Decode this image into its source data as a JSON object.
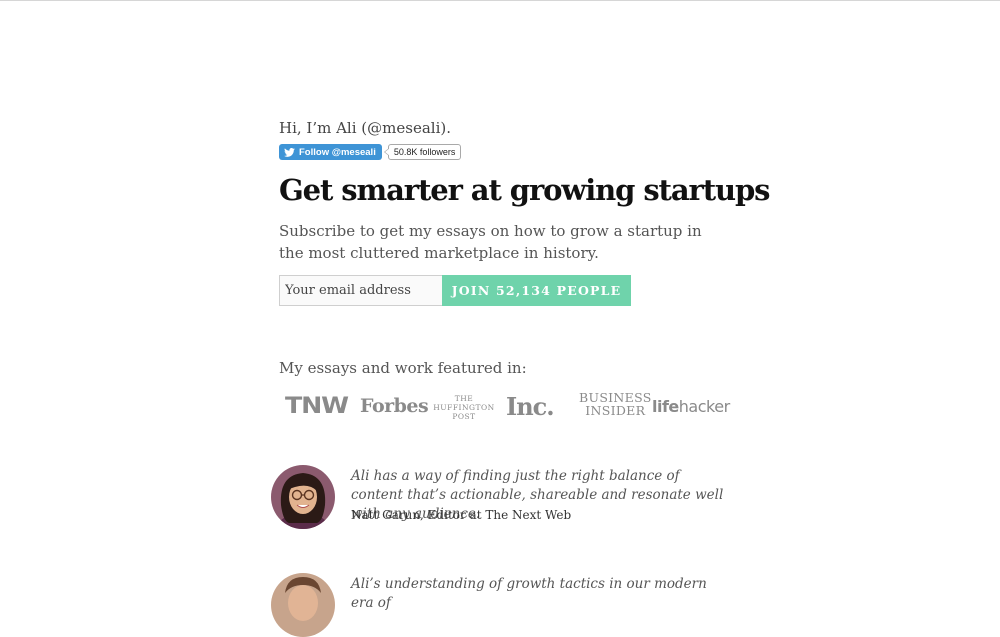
{
  "intro": "Hi, I’m Ali (@meseali).",
  "twitter": {
    "follow_label": "Follow @meseali",
    "followers": "50.8K followers",
    "brand_color": "#3e94d6"
  },
  "headline": "Get smarter at growing startups",
  "subtitle": "Subscribe to get my essays on how to grow a startup in the most cluttered marketplace in history.",
  "signup": {
    "email_placeholder": "Your email address",
    "join_label": "JOIN 52,134 PEOPLE",
    "accent_color": "#6fd3ab"
  },
  "featured": {
    "label": "My essays and work featured in:",
    "logos": {
      "tnw": "TNW",
      "forbes": "Forbes",
      "huffington_line1": "THE",
      "huffington_line2": "HUFFINGTON",
      "huffington_line3": "POST",
      "inc": "Inc.",
      "bi_line1": "BUSINESS",
      "bi_line2": "INSIDER",
      "lifehacker_a": "life",
      "lifehacker_b": "hacker"
    }
  },
  "testimonials": [
    {
      "quote": "Ali has a way of finding just the right balance of content that’s actionable, shareable and resonate well with any audience.",
      "author": "Natt Garun, Editor at The Next Web"
    },
    {
      "quote": "Ali’s understanding of growth tactics in our modern era of"
    }
  ]
}
